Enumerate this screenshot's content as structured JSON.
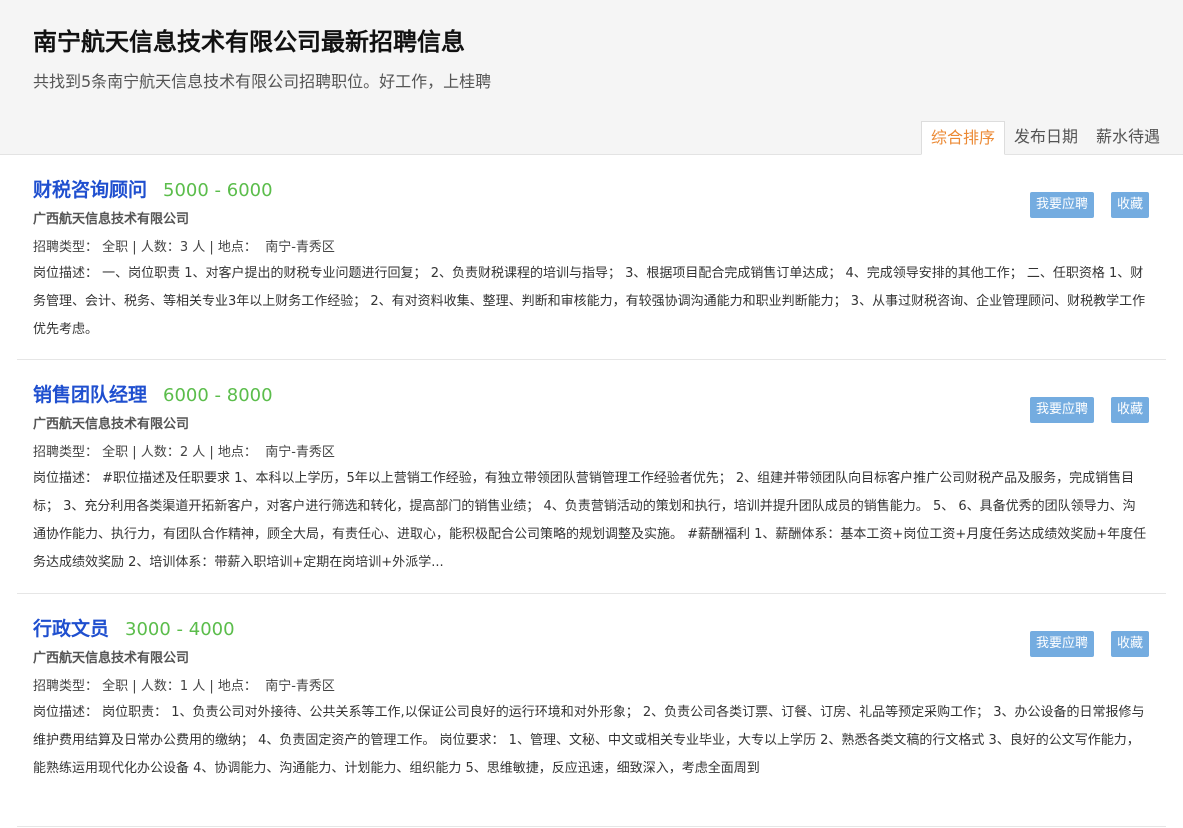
{
  "header": {
    "title": "南宁航天信息技术有限公司最新招聘信息",
    "subtitle": "共找到5条南宁航天信息技术有限公司招聘职位。好工作，上桂聘"
  },
  "tabs": [
    {
      "label": "综合排序",
      "active": true
    },
    {
      "label": "发布日期",
      "active": false
    },
    {
      "label": "薪水待遇",
      "active": false
    }
  ],
  "labels": {
    "type": "招聘类型：",
    "count": "人数：",
    "location": "地点：",
    "desc": "岗位描述：",
    "apply": "我要应聘",
    "favorite": "收藏"
  },
  "jobs": [
    {
      "title": "财税咨询顾问",
      "salary": "5000 - 6000",
      "company": "广西航天信息技术有限公司",
      "type": "全职",
      "count": "3 人",
      "location": "南宁-青秀区",
      "description": "一、岗位职责 1、对客户提出的财税专业问题进行回复； 2、负责财税课程的培训与指导； 3、根据项目配合完成销售订单达成； 4、完成领导安排的其他工作； 二、任职资格 1、财务管理、会计、税务、等相关专业3年以上财务工作经验； 2、有对资料收集、整理、判断和审核能力，有较强协调沟通能力和职业判断能力； 3、从事过财税咨询、企业管理顾问、财税教学工作优先考虑。"
    },
    {
      "title": "销售团队经理",
      "salary": "6000 - 8000",
      "company": "广西航天信息技术有限公司",
      "type": "全职",
      "count": "2 人",
      "location": "南宁-青秀区",
      "description": "#职位描述及任职要求 1、本科以上学历，5年以上营销工作经验，有独立带领团队营销管理工作经验者优先； 2、组建并带领团队向目标客户推广公司财税产品及服务，完成销售目标； 3、充分利用各类渠道开拓新客户，对客户进行筛选和转化，提高部门的销售业绩； 4、负责营销活动的策划和执行，培训并提升团队成员的销售能力。 5、 6、具备优秀的团队领导力、沟通协作能力、执行力，有团队合作精神，顾全大局，有责任心、进取心，能积极配合公司策略的规划调整及实施。 #薪酬福利 1、薪酬体系：基本工资+岗位工资+月度任务达成绩效奖励+年度任务达成绩效奖励 2、培训体系：带薪入职培训+定期在岗培训+外派学..."
    },
    {
      "title": "行政文员",
      "salary": "3000 - 4000",
      "company": "广西航天信息技术有限公司",
      "type": "全职",
      "count": "1 人",
      "location": "南宁-青秀区",
      "description": "岗位职责： 1、负责公司对外接待、公共关系等工作,以保证公司良好的运行环境和对外形象； 2、负责公司各类订票、订餐、订房、礼品等预定采购工作； 3、办公设备的日常报修与维护费用结算及日常办公费用的缴纳； 4、负责固定资产的管理工作。 岗位要求： 1、管理、文秘、中文或相关专业毕业，大专以上学历 2、熟悉各类文稿的行文格式 3、良好的公文写作能力，能熟练运用现代化办公设备 4、协调能力、沟通能力、计划能力、组织能力 5、思维敏捷，反应迅速，细致深入，考虑全面周到"
    }
  ]
}
